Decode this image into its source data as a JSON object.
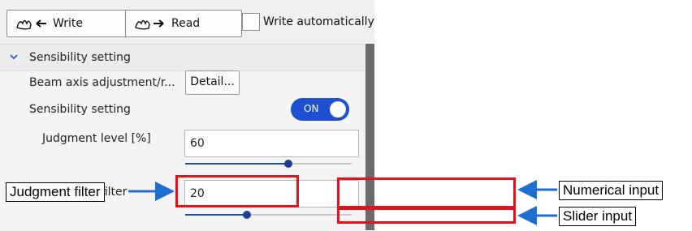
{
  "toolbar": {
    "write_label": "Write",
    "read_label": "Read",
    "write_auto_label": "Write automatically"
  },
  "section": {
    "title": "Sensibility setting"
  },
  "rows": {
    "beam_label": "Beam axis adjustment/r...",
    "detail_label": "Detail...",
    "sensibility_label": "Sensibility setting",
    "toggle_label": "ON",
    "judgment_level_label": "Judgment level [%]",
    "judgment_level_value": "60",
    "judgment_level_slider": 0.62,
    "judgment_filter_label": "Judgment filter",
    "judgment_filter_value": "20",
    "judgment_filter_slider": 0.37
  },
  "callouts": {
    "left": "Judgment filter",
    "numeric": "Numerical input",
    "slider": "Slider input"
  },
  "colors": {
    "highlight": "#e0141e",
    "arrow": "#1e6fd0",
    "toggle": "#1f4fd1"
  }
}
